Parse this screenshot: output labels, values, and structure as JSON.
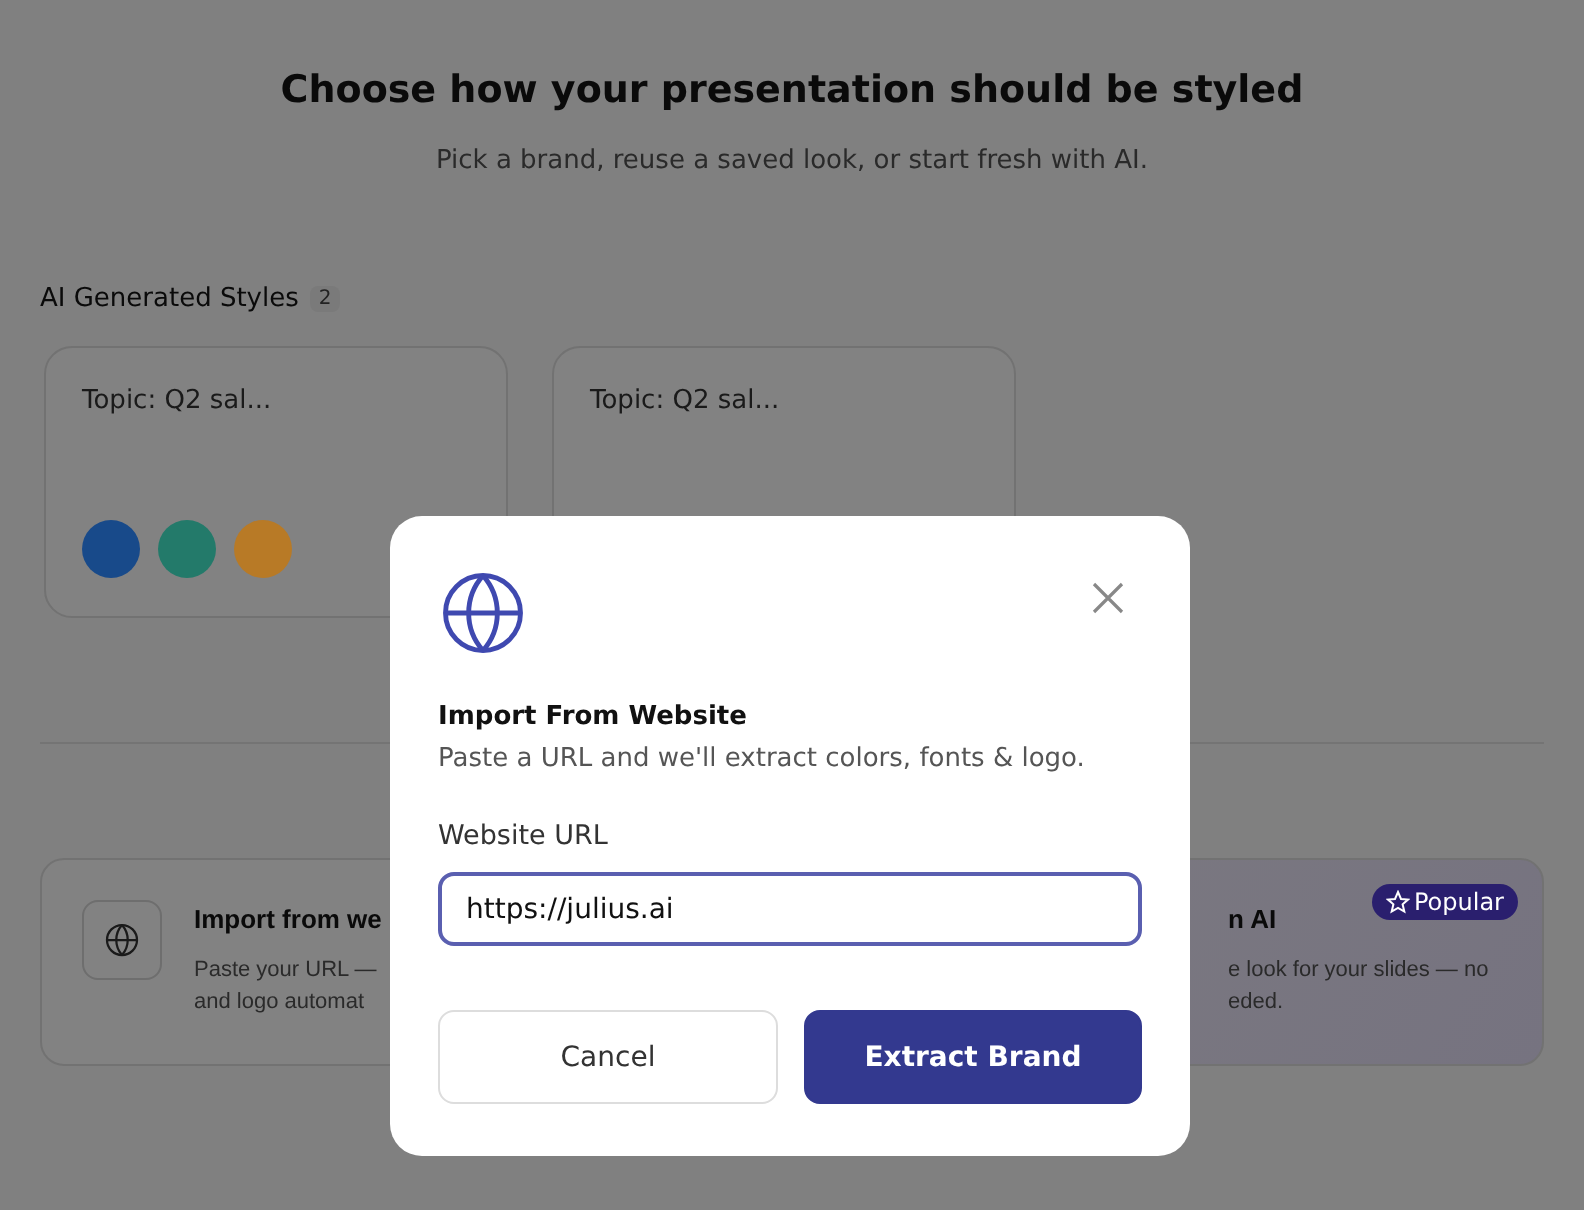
{
  "header": {
    "title": "Choose how your presentation should be styled",
    "subtitle": "Pick a brand, reuse a saved look, or start fresh with AI."
  },
  "ai_styles": {
    "label": "AI Generated Styles",
    "count": "2",
    "cards": [
      {
        "topic": "Topic: Q2 sal...",
        "swatches": [
          {
            "color": "#184a8a"
          },
          {
            "color": "#237a6a"
          },
          {
            "color": "#b87a26"
          }
        ]
      },
      {
        "topic": "Topic: Q2 sal..."
      }
    ]
  },
  "options": [
    {
      "kind": "import",
      "title": "Import from we",
      "lines": [
        "Paste your URL —",
        "and logo automat"
      ]
    },
    {
      "kind": "ai",
      "title": "n AI",
      "badge": "Popular",
      "lines": [
        "e look for your slides — no",
        "eded."
      ]
    }
  ],
  "dialog": {
    "title": "Import From Website",
    "description": "Paste a URL and we'll extract colors, fonts & logo.",
    "field_label": "Website URL",
    "field_value": "https://julius.ai",
    "buttons": [
      {
        "label": "Cancel",
        "kind": "secondary"
      },
      {
        "label": "Extract Brand",
        "kind": "primary"
      }
    ]
  }
}
